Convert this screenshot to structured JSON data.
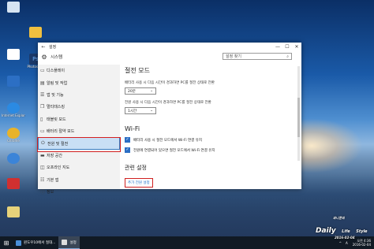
{
  "desktop_icons": [
    {
      "label": "",
      "color": "#d6e4f2",
      "x_note": "recycle"
    },
    {
      "label": "",
      "color": "#f0c040"
    },
    {
      "label": "Ps",
      "color": "#1c3a6b"
    },
    {
      "label": "Photoshop",
      "color": "#2c2c2c"
    },
    {
      "label": "",
      "color": "#ffffff"
    },
    {
      "label": "",
      "color": "#2c6fc4"
    },
    {
      "label": "Internet Explorer",
      "color": "#2b8ae2"
    },
    {
      "label": "Chrome",
      "color": "#e8b32a"
    },
    {
      "label": "",
      "color": "#3b84d8"
    },
    {
      "label": "",
      "color": "#d03030"
    },
    {
      "label": "",
      "color": "#e6d27a"
    }
  ],
  "window": {
    "app_title": "설정",
    "back_glyph": "←",
    "controls": {
      "minimize": "—",
      "maximize": "☐",
      "close": "✕"
    },
    "header_title": "시스템",
    "search_placeholder": "설정 찾기",
    "search_icon": "⌕"
  },
  "sidebar": {
    "items": [
      {
        "label": "디스플레이",
        "icon": "▭"
      },
      {
        "label": "알림 및 작업",
        "icon": "▤"
      },
      {
        "label": "앱 및 기능",
        "icon": "☰"
      },
      {
        "label": "멀티태스킹",
        "icon": "❐"
      },
      {
        "label": "태블릿 모드",
        "icon": "▯"
      },
      {
        "label": "배터리 절약 모드",
        "icon": "▭"
      },
      {
        "label": "전원 및 절전",
        "icon": "⏻"
      },
      {
        "label": "저장 공간",
        "icon": "▬"
      },
      {
        "label": "오프라인 지도",
        "icon": "◫"
      },
      {
        "label": "기본 앱",
        "icon": "☷"
      },
      {
        "label": "정보",
        "icon": "ⓘ"
      }
    ],
    "selected_index": 6
  },
  "content": {
    "sleep_heading": "절전 모드",
    "battery_sleep_label": "배터리 사용 시 다음 시간이 경과하면 PC를 절전 상태로 전환",
    "battery_sleep_value": "20분",
    "plugged_sleep_label": "전원 사용 시 다음 시간이 경과하면 PC를 절전 상태로 전환",
    "plugged_sleep_value": "1시간",
    "wifi_heading": "Wi-Fi",
    "wifi_check1": "배터리 사용 시 절전 모드에서 Wi-Fi 연결 유지",
    "wifi_check2": "전원에 연결되어 있으면 절전 모드에서 Wi-Fi 연결 유지",
    "check_glyph": "✓",
    "related_heading": "관련 설정",
    "related_link": "추가 전원 설정"
  },
  "taskbar": {
    "start_glyph": "⊞",
    "apps": [
      {
        "label": "윈도우10에서 절대..."
      },
      {
        "label": "설정"
      }
    ],
    "tray_up": "^",
    "tray_lang": "A",
    "time": "오전 4:36",
    "date": "2016-02-04"
  },
  "watermark": {
    "small": "와니쿤의",
    "main": "Daily",
    "life": "Life",
    "style": "Style",
    "date": "2016-02-04"
  },
  "colors": {
    "accent": "#2b6ec4",
    "highlight": "#d42020",
    "link": "#1f6fc7"
  }
}
